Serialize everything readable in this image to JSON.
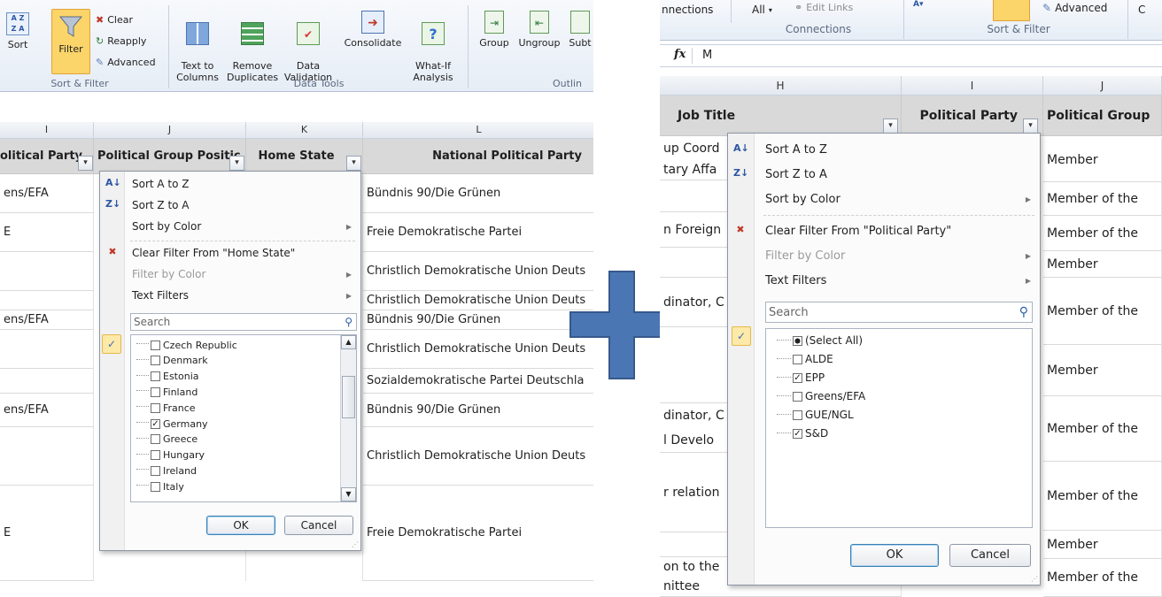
{
  "left": {
    "ribbon": {
      "sort_label": "Sort",
      "filter_label": "Filter",
      "clear_label": "Clear",
      "reapply_label": "Reapply",
      "advanced_label": "Advanced",
      "sort_filter_group": "Sort & Filter",
      "text_to_columns": "Text to\nColumns",
      "remove_duplicates": "Remove\nDuplicates",
      "data_validation": "Data\nValidation",
      "consolidate": "Consolidate",
      "what_if": "What-If\nAnalysis",
      "data_tools_group": "Data Tools",
      "group": "Group",
      "ungroup": "Ungroup",
      "subtotal": "Subt",
      "outline_group": "Outlin"
    },
    "columns": [
      "I",
      "J",
      "K",
      "L"
    ],
    "headers": {
      "political_party": "olitical Party",
      "political_group_position": "Political Group Positic",
      "home_state": "Home State",
      "national_political_party": "National Political Party"
    },
    "col_i_values": [
      "ens/EFA",
      "E",
      "",
      "",
      "ens/EFA",
      "",
      "",
      "ens/EFA",
      "",
      "E"
    ],
    "col_l_values": [
      "Bündnis 90/Die Grünen",
      "Freie Demokratische Partei",
      "Christlich Demokratische Union Deuts",
      "Christlich Demokratische Union Deuts",
      "Bündnis 90/Die Grünen",
      "Christlich Demokratische Union Deuts",
      "Sozialdemokratische Partei Deutschla",
      "Bündnis 90/Die Grünen",
      "Christlich Demokratische Union Deuts",
      "Freie Demokratische Partei"
    ],
    "menu": {
      "sort_az": "Sort A to Z",
      "sort_za": "Sort Z to A",
      "sort_by_color": "Sort by Color",
      "clear_filter": "Clear Filter From \"Home State\"",
      "filter_by_color": "Filter by Color",
      "text_filters": "Text Filters",
      "search_placeholder": "Search",
      "items": [
        {
          "label": "Czech Republic",
          "checked": false
        },
        {
          "label": "Denmark",
          "checked": false
        },
        {
          "label": "Estonia",
          "checked": false
        },
        {
          "label": "Finland",
          "checked": false
        },
        {
          "label": "France",
          "checked": false
        },
        {
          "label": "Germany",
          "checked": true
        },
        {
          "label": "Greece",
          "checked": false
        },
        {
          "label": "Hungary",
          "checked": false
        },
        {
          "label": "Ireland",
          "checked": false
        },
        {
          "label": "Italy",
          "checked": false
        }
      ],
      "ok": "OK",
      "cancel": "Cancel"
    }
  },
  "right": {
    "ribbon": {
      "connections_btn": "nnections",
      "all_btn": "All",
      "edit_links": "Edit Links",
      "connections_group": "Connections",
      "advanced_label": "Advanced",
      "sort_filter_group": "Sort & Filter",
      "cut_c": "C"
    },
    "formula": {
      "fx": "fx",
      "value": "M"
    },
    "columns": [
      "H",
      "I",
      "J"
    ],
    "headers": {
      "job_title": "Job Title",
      "political_party": "Political Party",
      "political_group": "Political Group"
    },
    "col_h_values": [
      "up Coord",
      "tary Affa",
      "",
      "n Foreign",
      "",
      "dinator, C",
      "",
      "dinator, C",
      "l Develo",
      "r relation",
      "",
      "on to the",
      "nittee"
    ],
    "col_j_values": [
      "Member",
      "Member of the",
      "Member of the",
      "Member",
      "Member of the",
      "Member",
      "Member of the",
      "Member of the",
      "Member",
      "Member of the"
    ],
    "menu": {
      "sort_az": "Sort A to Z",
      "sort_za": "Sort Z to A",
      "sort_by_color": "Sort by Color",
      "clear_filter": "Clear Filter From \"Political Party\"",
      "filter_by_color": "Filter by Color",
      "text_filters": "Text Filters",
      "search_placeholder": "Search",
      "items": [
        {
          "label": "(Select All)",
          "state": "partial"
        },
        {
          "label": "ALDE",
          "state": "unchecked"
        },
        {
          "label": "EPP",
          "state": "checked"
        },
        {
          "label": "Greens/EFA",
          "state": "unchecked"
        },
        {
          "label": "GUE/NGL",
          "state": "unchecked"
        },
        {
          "label": "S&D",
          "state": "checked"
        }
      ],
      "ok": "OK",
      "cancel": "Cancel"
    }
  },
  "colors": {
    "plus_fill": "#4a77b4",
    "plus_stroke": "#36598c",
    "header_gray": "#d9d9d9",
    "filter_active": "#fbd46a"
  }
}
